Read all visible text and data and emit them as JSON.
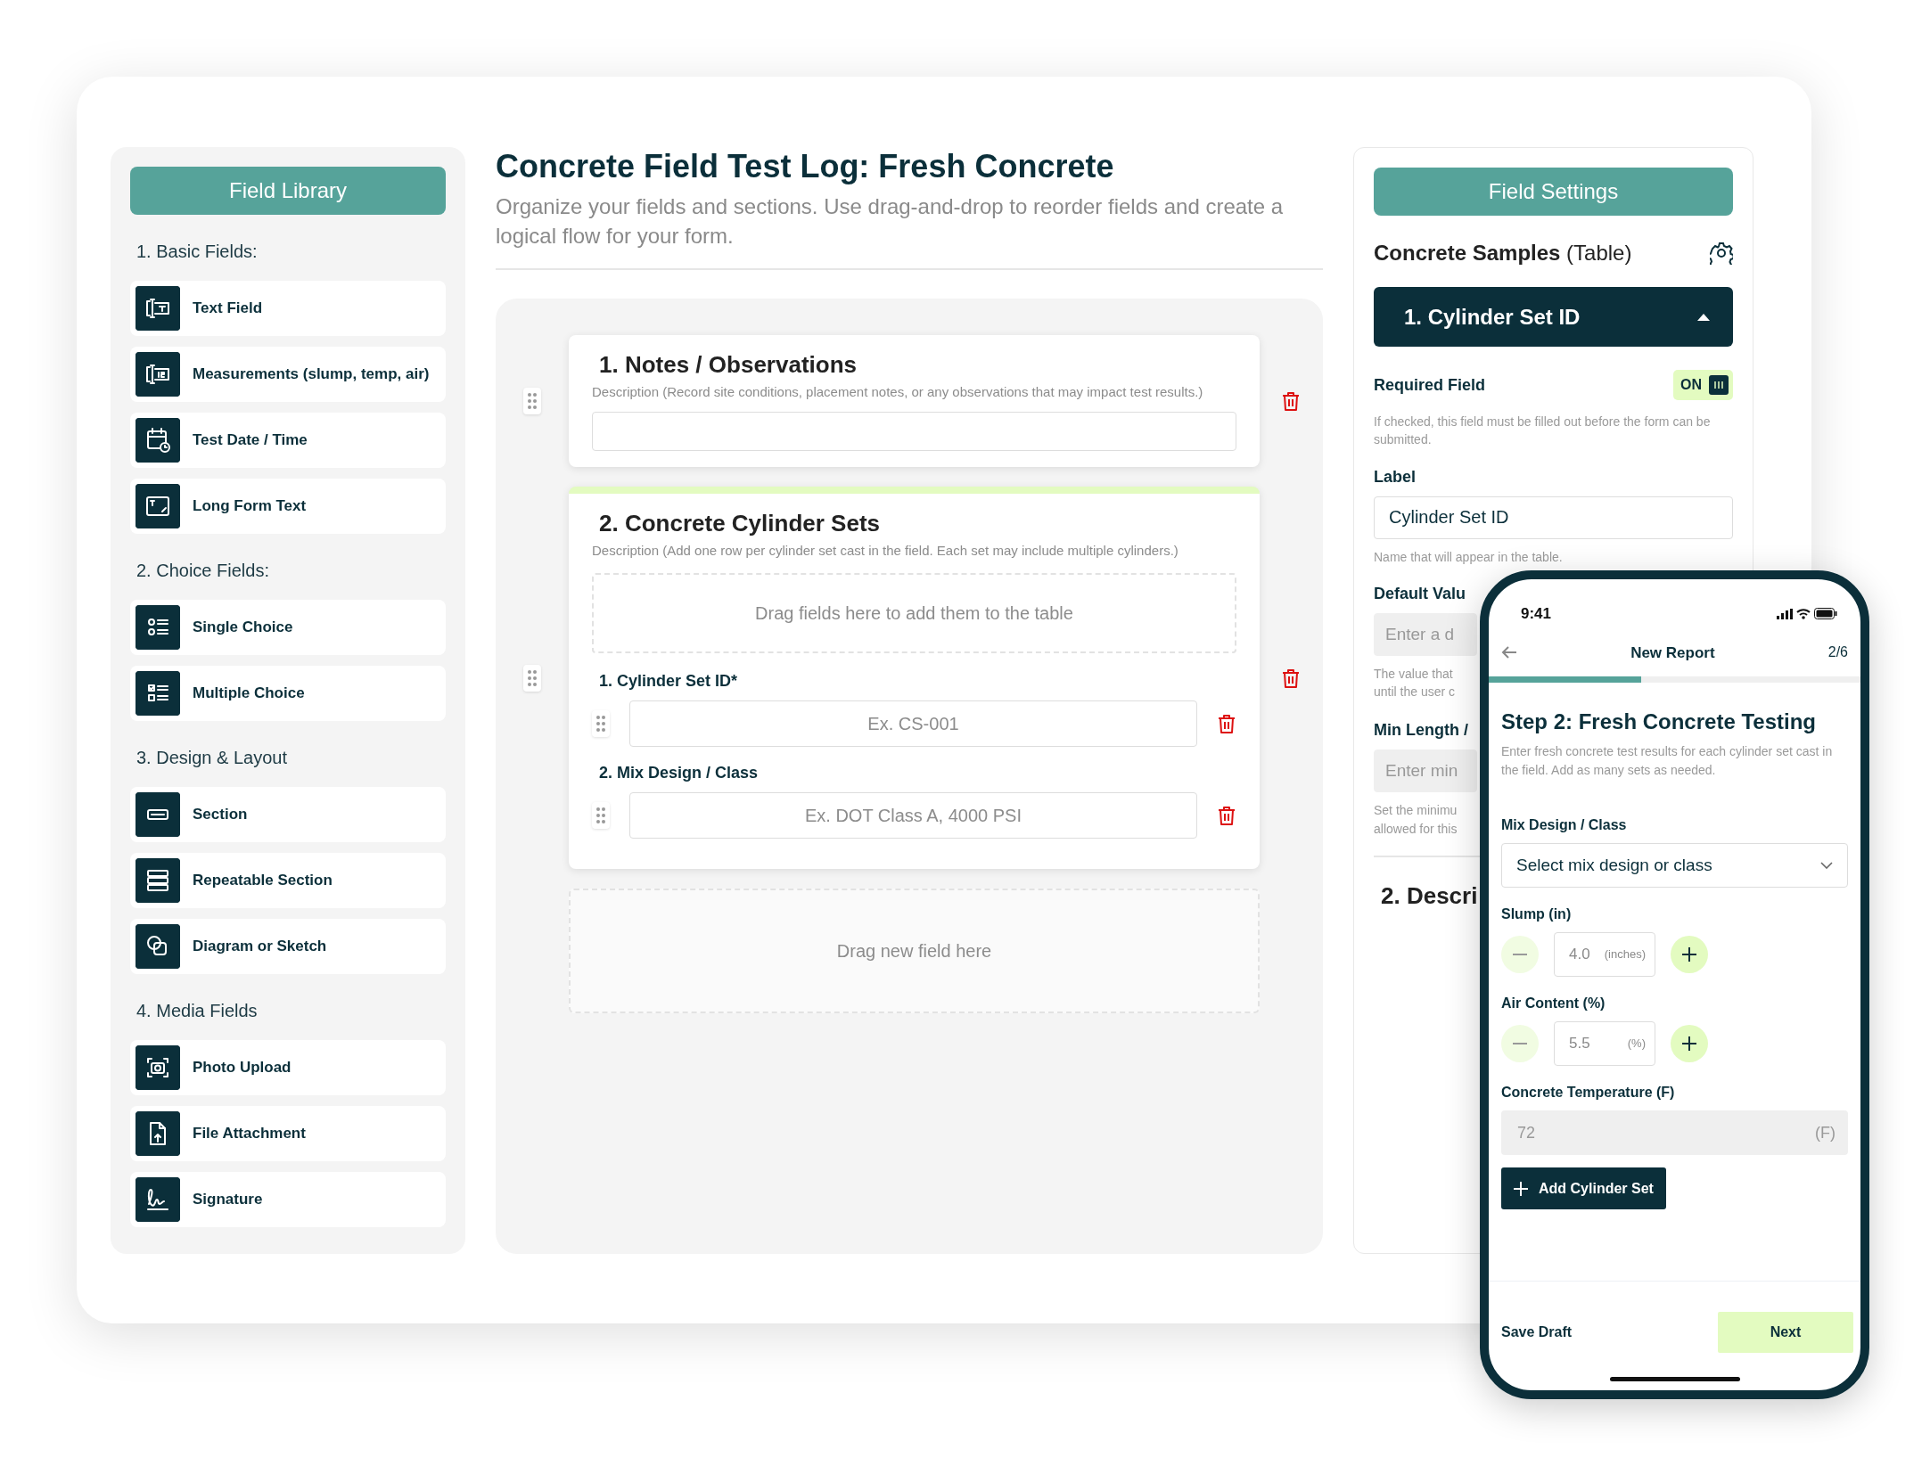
{
  "field_library": {
    "title": "Field Library",
    "groups": [
      {
        "heading": "1. Basic Fields:",
        "items": [
          "Text Field",
          "Measurements (slump, temp, air)",
          "Test Date / Time",
          "Long Form Text"
        ]
      },
      {
        "heading": "2. Choice Fields:",
        "items": [
          "Single Choice",
          "Multiple Choice"
        ]
      },
      {
        "heading": "3. Design & Layout",
        "items": [
          "Section",
          "Repeatable Section",
          "Diagram or Sketch"
        ]
      },
      {
        "heading": "4. Media Fields",
        "items": [
          "Photo Upload",
          "File Attachment",
          "Signature"
        ]
      }
    ]
  },
  "builder": {
    "title": "Concrete Field Test Log: Fresh Concrete",
    "subtitle": "Organize your fields and sections. Use drag-and-drop to reorder fields and create a logical flow for your form.",
    "sections": [
      {
        "kind": "text",
        "number": "1.",
        "title": "Notes / Observations",
        "description": "Description (Record site conditions, placement notes, or any observations that may impact test results.)",
        "selected": false
      },
      {
        "kind": "table",
        "number": "2.",
        "title": "Concrete Cylinder Sets",
        "description": "Description (Add one row per cylinder set cast in the field. Each set may include multiple cylinders.)",
        "selected": true,
        "drop_hint": "Drag fields here to add them to the table",
        "columns": [
          {
            "number": "1.",
            "label": "Cylinder Set ID*",
            "placeholder": "Ex. CS-001"
          },
          {
            "number": "2.",
            "label": "Mix Design / Class",
            "placeholder": "Ex. DOT Class A, 4000 PSI"
          }
        ]
      }
    ],
    "drop_zone": "Drag new field here"
  },
  "field_settings": {
    "title": "Field Settings",
    "table_name": "Concrete Samples",
    "table_type": "(Table)",
    "accordion": {
      "title": "1. Cylinder Set ID",
      "expanded": true
    },
    "required": {
      "label": "Required Field",
      "on": true,
      "state_text": "ON",
      "help": "If checked, this field must be filled out before the form can be submitted."
    },
    "label_field": {
      "label": "Label",
      "value": "Cylinder Set ID",
      "help": "Name that will appear in the table."
    },
    "default_field": {
      "label": "Default Valu",
      "placeholder": "Enter a d",
      "help_lines": [
        "The value that",
        "until the user c"
      ]
    },
    "min_length_field": {
      "label": "Min Length /",
      "placeholder": "Enter min",
      "help_lines": [
        "Set the minimu",
        "allowed for this"
      ]
    },
    "next_section": "2. Descri"
  },
  "phone": {
    "time": "9:41",
    "title": "New Report",
    "step_count": "2/6",
    "progress": {
      "level": 0.41
    },
    "step_title": "Step 2: Fresh Concrete Testing",
    "step_description": "Enter fresh concrete test results for each cylinder set cast in the field. Add as many sets as needed.",
    "fields": [
      {
        "kind": "select",
        "label": "Mix Design / Class",
        "placeholder": "Select mix design or class"
      },
      {
        "kind": "stepper",
        "label": "Slump (in)",
        "value": "4.0",
        "unit": "(inches)"
      },
      {
        "kind": "stepper",
        "label": "Air Content (%)",
        "value": "5.5",
        "unit": "(%)"
      },
      {
        "kind": "number",
        "label": "Concrete Temperature (F)",
        "value": "72",
        "unit": "(F)",
        "disabled": true
      }
    ],
    "add_button": "Add Cylinder Set",
    "save_button": "Save Draft",
    "next_button": "Next"
  }
}
